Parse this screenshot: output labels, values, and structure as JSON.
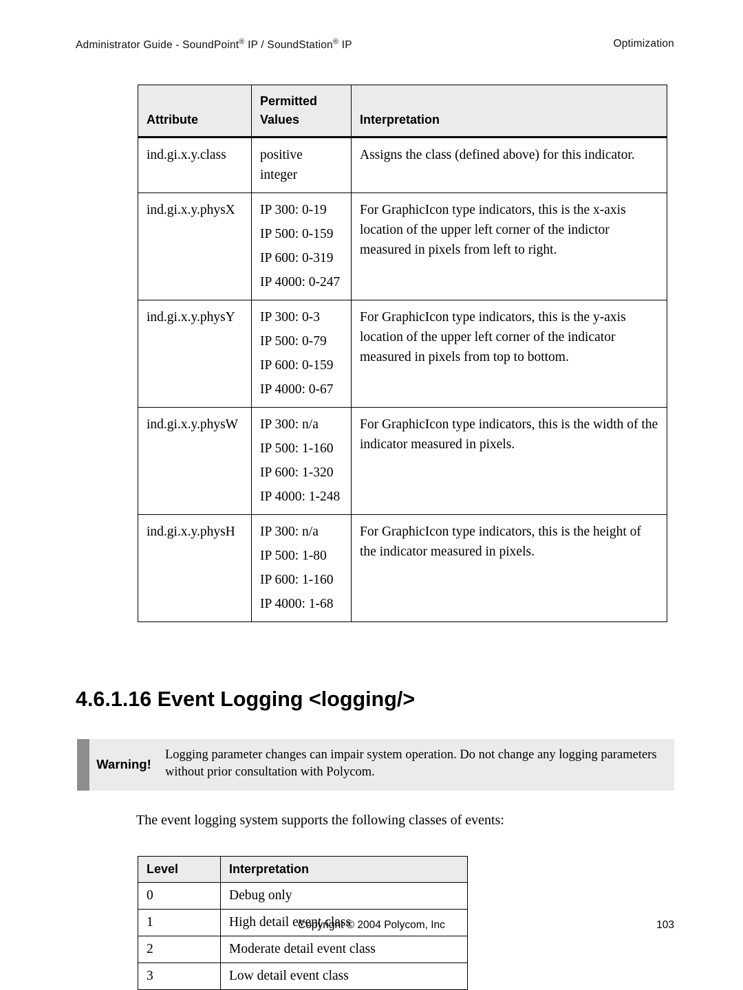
{
  "header": {
    "left_a": "Administrator Guide - SoundPoint",
    "left_b": " IP / SoundStation",
    "left_c": " IP",
    "reg": "®",
    "right": "Optimization"
  },
  "attr_table": {
    "headers": {
      "attribute": "Attribute",
      "permitted": "Permitted Values",
      "interpretation": "Interpretation"
    },
    "rows": [
      {
        "attribute": "ind.gi.x.y.class",
        "permitted": [
          "positive integer"
        ],
        "interpretation": "Assigns the class (defined above) for this indicator."
      },
      {
        "attribute": "ind.gi.x.y.physX",
        "permitted": [
          "IP 300: 0-19",
          "IP 500: 0-159",
          "IP 600: 0-319",
          "IP 4000: 0-247"
        ],
        "interpretation": "For GraphicIcon type indicators, this is the x-axis location of the upper left corner of the indictor measured in pixels from left to right."
      },
      {
        "attribute": "ind.gi.x.y.physY",
        "permitted": [
          "IP 300: 0-3",
          "IP 500: 0-79",
          "IP 600: 0-159",
          "IP 4000: 0-67"
        ],
        "interpretation": "For GraphicIcon type indicators, this is the y-axis location of the upper left corner of the indicator measured in pixels from top to bottom."
      },
      {
        "attribute": "ind.gi.x.y.physW",
        "permitted": [
          "IP 300: n/a",
          "IP 500: 1-160",
          "IP 600: 1-320",
          "IP 4000: 1-248"
        ],
        "interpretation": "For GraphicIcon type indicators, this is the width of the indicator measured in pixels."
      },
      {
        "attribute": "ind.gi.x.y.physH",
        "permitted": [
          "IP 300: n/a",
          "IP 500: 1-80",
          "IP 600: 1-160",
          "IP 4000: 1-68"
        ],
        "interpretation": "For GraphicIcon type indicators, this is the height of the indicator measured in pixels."
      }
    ]
  },
  "section": {
    "heading": "4.6.1.16  Event Logging <logging/>"
  },
  "warning": {
    "label": "Warning!",
    "text": "Logging parameter changes can impair system operation.  Do not change any logging parameters without prior consultation with Polycom."
  },
  "intro": "The event logging system supports the following classes of events:",
  "level_table": {
    "headers": {
      "level": "Level",
      "interpretation": "Interpretation"
    },
    "rows": [
      {
        "level": "0",
        "interpretation": "Debug only"
      },
      {
        "level": "1",
        "interpretation": "High detail event class"
      },
      {
        "level": "2",
        "interpretation": "Moderate detail event class"
      },
      {
        "level": "3",
        "interpretation": "Low detail event class"
      }
    ]
  },
  "footer": {
    "copyright": "Copyright © 2004 Polycom, Inc",
    "page": "103"
  }
}
